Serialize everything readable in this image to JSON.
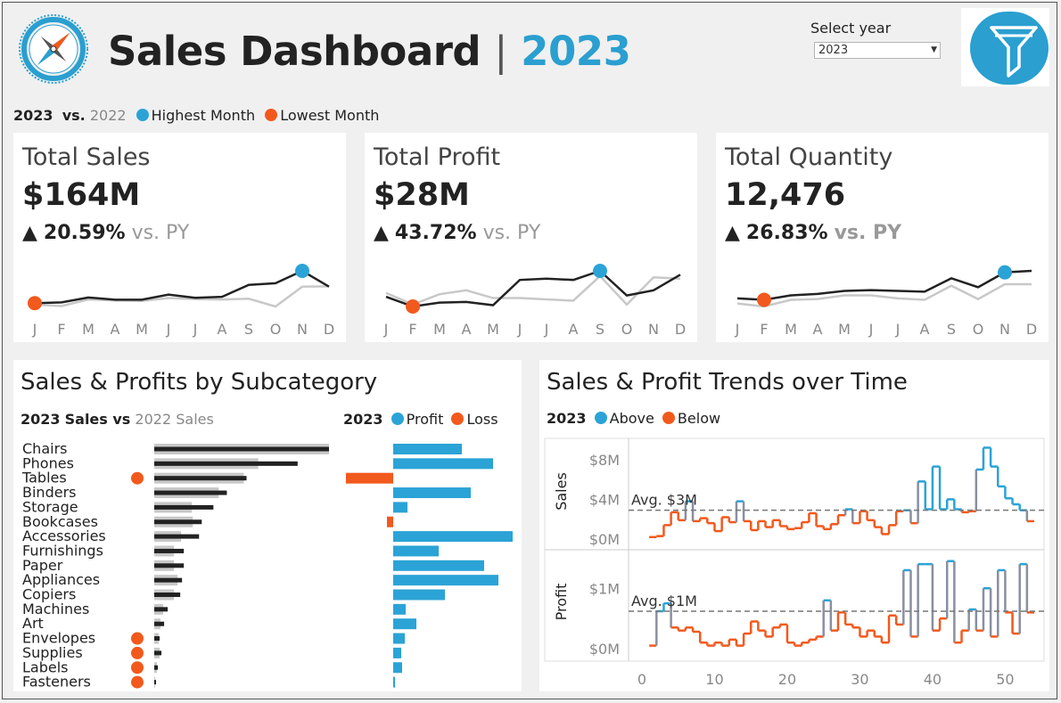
{
  "header": {
    "title": "Sales Dashboard",
    "separator": "|",
    "year": "2023",
    "select_label": "Select year",
    "select_value": "2023",
    "filter_icon": "filter-funnel-icon",
    "logo_icon": "compass-icon"
  },
  "colors": {
    "accent": "#2a9fd0",
    "highlight": "#2ba3d6",
    "low": "#f2591c",
    "current": "#222222",
    "previous": "#c8c8c8"
  },
  "kpi_legend": {
    "year": "2023",
    "vs": "vs.",
    "prev_year": "2022",
    "highest": "Highest Month",
    "lowest": "Lowest Month"
  },
  "months": [
    "J",
    "F",
    "M",
    "A",
    "M",
    "J",
    "J",
    "A",
    "S",
    "O",
    "N",
    "D"
  ],
  "kpis": [
    {
      "title": "Total Sales",
      "value": "$164M",
      "arrow": "▲",
      "change": "20.59%",
      "vs": "vs. PY",
      "current": [
        2,
        2.3,
        4.3,
        3.4,
        3.4,
        5.5,
        4.2,
        4.6,
        9.5,
        10.2,
        15.3,
        8.8
      ],
      "previous": [
        1.4,
        0.8,
        3.5,
        3.1,
        2.9,
        4.1,
        3.7,
        3.5,
        3.8,
        0.6,
        8.8,
        8.9
      ],
      "high_index": 10,
      "low_index": 0
    },
    {
      "title": "Total Profit",
      "value": "$28M",
      "arrow": "▲",
      "change": "43.72%",
      "vs": "vs. PY",
      "current": [
        0.9,
        0.15,
        0.45,
        0.5,
        0.25,
        2.2,
        2.3,
        2.2,
        2.9,
        1.0,
        1.4,
        2.6
      ],
      "previous": [
        1.2,
        0.3,
        1.1,
        1.4,
        0.8,
        0.8,
        0.7,
        0.6,
        2.5,
        0.3,
        2.4,
        2.3
      ],
      "high_index": 8,
      "low_index": 1
    },
    {
      "title": "Total Quantity",
      "value": "12,476",
      "arrow": "▲",
      "change": "26.83%",
      "vs": "vs. PY",
      "current": [
        0.55,
        0.45,
        0.75,
        0.85,
        1.05,
        1.1,
        1.05,
        1.0,
        1.9,
        1.3,
        2.3,
        2.4
      ],
      "previous": [
        0.2,
        0.0,
        0.45,
        0.5,
        0.75,
        0.75,
        0.55,
        0.45,
        1.4,
        0.5,
        1.5,
        1.5
      ],
      "high_index": 10,
      "low_index": 1
    }
  ],
  "subcategory": {
    "title": "Sales & Profits by Subcategory",
    "sales_legend": {
      "year": "2023",
      "mid": "Sales vs",
      "prev": "2022 Sales"
    },
    "profit_legend": {
      "year": "2023",
      "profit": "Profit",
      "loss": "Loss"
    },
    "items": [
      {
        "name": "Chairs",
        "sales": 195,
        "prev": 195,
        "profit": 77,
        "flag": false
      },
      {
        "name": "Phones",
        "sales": 160,
        "prev": 116,
        "profit": 112,
        "flag": false
      },
      {
        "name": "Tables",
        "sales": 103,
        "prev": 100,
        "profit": -53,
        "flag": true
      },
      {
        "name": "Binders",
        "sales": 81,
        "prev": 72,
        "profit": 87,
        "flag": false
      },
      {
        "name": "Storage",
        "sales": 66,
        "prev": 42,
        "profit": 16,
        "flag": false
      },
      {
        "name": "Bookcases",
        "sales": 53,
        "prev": 43,
        "profit": -7,
        "flag": false
      },
      {
        "name": "Accessories",
        "sales": 50,
        "prev": 30,
        "profit": 134,
        "flag": false
      },
      {
        "name": "Furnishings",
        "sales": 33,
        "prev": 22,
        "profit": 51,
        "flag": false
      },
      {
        "name": "Paper",
        "sales": 33,
        "prev": 22,
        "profit": 102,
        "flag": false
      },
      {
        "name": "Appliances",
        "sales": 31,
        "prev": 26,
        "profit": 118,
        "flag": false
      },
      {
        "name": "Copiers",
        "sales": 29,
        "prev": 22,
        "profit": 58,
        "flag": false
      },
      {
        "name": "Machines",
        "sales": 15,
        "prev": 10,
        "profit": 14,
        "flag": false
      },
      {
        "name": "Art",
        "sales": 11,
        "prev": 7,
        "profit": 26,
        "flag": false
      },
      {
        "name": "Envelopes",
        "sales": 6,
        "prev": 5,
        "profit": 13,
        "flag": true
      },
      {
        "name": "Supplies",
        "sales": 8,
        "prev": 6,
        "profit": 9,
        "flag": true
      },
      {
        "name": "Labels",
        "sales": 4,
        "prev": 3,
        "profit": 10,
        "flag": true
      },
      {
        "name": "Fasteners",
        "sales": 2,
        "prev": 1,
        "profit": 2,
        "flag": true
      }
    ]
  },
  "trends": {
    "title": "Sales & Profit Trends over Time",
    "legend": {
      "year": "2023",
      "above": "Above",
      "below": "Below"
    },
    "x_ticks": [
      "0",
      "10",
      "20",
      "30",
      "40",
      "50"
    ],
    "sales": {
      "label": "Sales",
      "ticks": [
        "$0M",
        "$4M",
        "$8M"
      ],
      "avg_label": "Avg. $3M",
      "avg": 2.9,
      "values": [
        0.2,
        0.3,
        1.4,
        2.7,
        1.9,
        3.8,
        1.8,
        2.1,
        1.6,
        0.8,
        2.2,
        1.7,
        3.8,
        1.8,
        0.9,
        1.8,
        1.2,
        1.9,
        1.3,
        1.0,
        1.1,
        1.7,
        2.6,
        1.3,
        1.0,
        1.5,
        2.4,
        3.0,
        1.6,
        2.8,
        1.9,
        1.2,
        0.5,
        1.4,
        2.8,
        2.9,
        1.6,
        5.8,
        3.0,
        7.3,
        3.0,
        4.0,
        3.0,
        2.7,
        2.8,
        7.0,
        9.2,
        7.3,
        5.3,
        4.1,
        3.5,
        2.9,
        1.8
      ]
    },
    "profit": {
      "label": "Profit",
      "ticks": [
        "$0M",
        "$1M"
      ],
      "avg_label": "Avg. $1M",
      "avg": 0.62,
      "values": [
        0.05,
        0.62,
        0.75,
        0.35,
        0.3,
        0.35,
        0.28,
        0.1,
        0.05,
        0.1,
        0.05,
        0.15,
        0.05,
        0.25,
        0.45,
        0.3,
        0.2,
        0.35,
        0.4,
        0.1,
        0.05,
        0.1,
        0.15,
        0.2,
        0.8,
        0.3,
        0.6,
        0.4,
        0.35,
        0.2,
        0.3,
        0.2,
        0.1,
        0.55,
        0.4,
        1.3,
        0.2,
        1.4,
        1.4,
        0.3,
        0.5,
        1.45,
        0.1,
        0.3,
        0.65,
        0.3,
        1.0,
        0.2,
        1.3,
        0.6,
        0.25,
        1.4,
        0.6
      ]
    }
  }
}
